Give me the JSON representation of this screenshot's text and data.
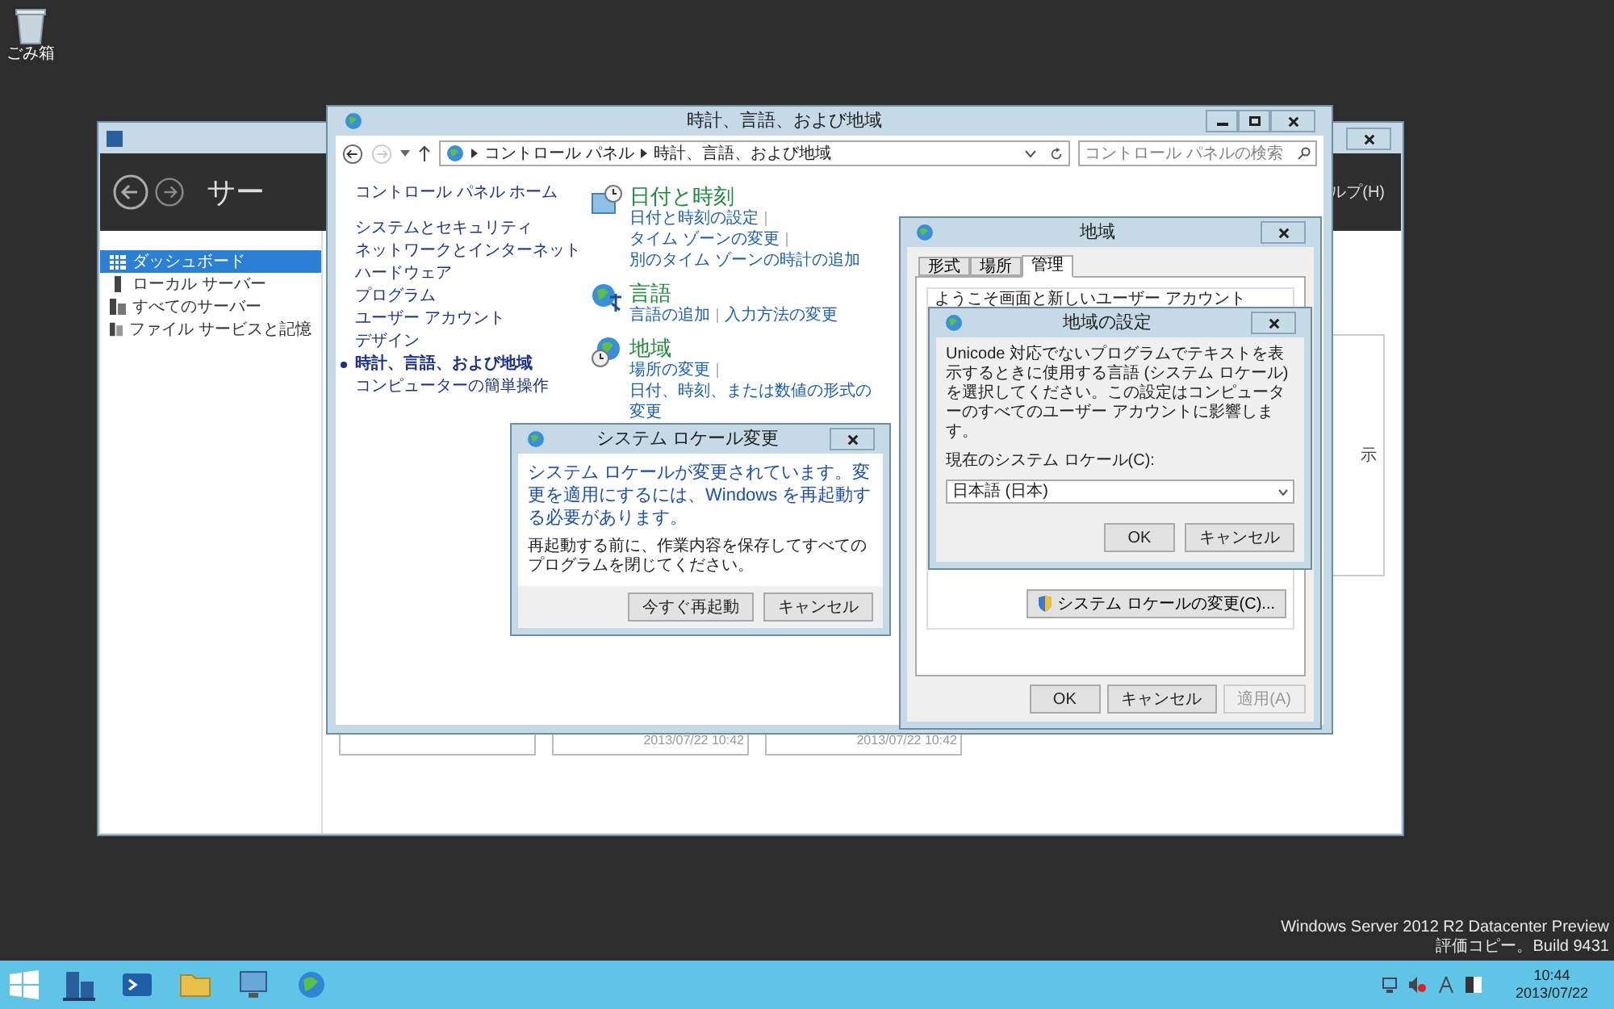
{
  "desktop": {
    "icons": [
      {
        "label": "ごみ箱"
      }
    ],
    "os_notice": [
      "Windows Server 2012 R2 Datacenter Preview",
      "評価コピー。Build 9431"
    ]
  },
  "server_manager": {
    "header_title": "サー",
    "menu_fragment": "ルプ(H)",
    "nav": [
      {
        "label": "ダッシュボード",
        "selected": true
      },
      {
        "label": "ローカル サーバー",
        "selected": false
      },
      {
        "label": "すべてのサーバー",
        "selected": false
      },
      {
        "label": "ファイル サービスと記憶",
        "selected": false
      }
    ],
    "panel_fragment": "示",
    "tiles": [
      {
        "timestamp": "2013/07/22 10:42"
      },
      {
        "timestamp": "2013/07/22 10:42"
      }
    ]
  },
  "control_panel": {
    "title": "時計、言語、および地域",
    "breadcrumb": [
      "コントロール パネル",
      "時計、言語、および地域"
    ],
    "search": {
      "placeholder": "コントロール パネルの検索"
    },
    "home": "コントロール パネル ホーム",
    "nav": [
      {
        "label": "システムとセキュリティ",
        "selected": false
      },
      {
        "label": "ネットワークとインターネット",
        "selected": false
      },
      {
        "label": "ハードウェア",
        "selected": false
      },
      {
        "label": "プログラム",
        "selected": false
      },
      {
        "label": "ユーザー アカウント",
        "selected": false
      },
      {
        "label": "デザイン",
        "selected": false
      },
      {
        "label": "時計、言語、および地域",
        "selected": true
      },
      {
        "label": "コンピューターの簡単操作",
        "selected": false
      }
    ],
    "categories": [
      {
        "kind": "clock",
        "title": "日付と時刻",
        "links": [
          "日付と時刻の設定",
          "タイム ゾーンの変更",
          "別のタイム ゾーンの時計の追加"
        ]
      },
      {
        "kind": "language",
        "title": "言語",
        "links": [
          "言語の追加",
          "入力方法の変更"
        ]
      },
      {
        "kind": "region",
        "title": "地域",
        "links": [
          "場所の変更",
          "日付、時刻、または数値の形式の変更"
        ]
      }
    ]
  },
  "locale_change_dialog": {
    "title": "システム ロケール変更",
    "message": "システム ロケールが変更されています。変更を適用にするには、Windows を再起動する必要があります。",
    "note": "再起動する前に、作業内容を保存してすべてのプログラムを閉じてください。",
    "buttons": [
      "今すぐ再起動",
      "キャンセル"
    ]
  },
  "region_dialog": {
    "title": "地域",
    "tabs": [
      {
        "label": "形式",
        "selected": false
      },
      {
        "label": "場所",
        "selected": false
      },
      {
        "label": "管理",
        "selected": true
      }
    ],
    "group_label": "ようこそ画面と新しいユーザー アカウント",
    "change_button": "システム ロケールの変更(C)...",
    "buttons": [
      {
        "label": "OK",
        "disabled": false
      },
      {
        "label": "キャンセル",
        "disabled": false
      },
      {
        "label": "適用(A)",
        "disabled": true
      }
    ]
  },
  "locale_settings_dialog": {
    "title": "地域の設定",
    "description": "Unicode 対応でないプログラムでテキストを表示するときに使用する言語 (システム ロケール) を選択してください。この設定はコンピューターのすべてのユーザー アカウントに影響します。",
    "field_label": "現在のシステム ロケール(C):",
    "value": "日本語 (日本)",
    "buttons": [
      "OK",
      "キャンセル"
    ]
  },
  "taskbar": {
    "apps": [
      {
        "kind": "server"
      },
      {
        "kind": "shell"
      },
      {
        "kind": "folder"
      },
      {
        "kind": "monitor"
      },
      {
        "kind": "globe"
      }
    ],
    "time": "10:44",
    "date": "2013/07/22"
  }
}
